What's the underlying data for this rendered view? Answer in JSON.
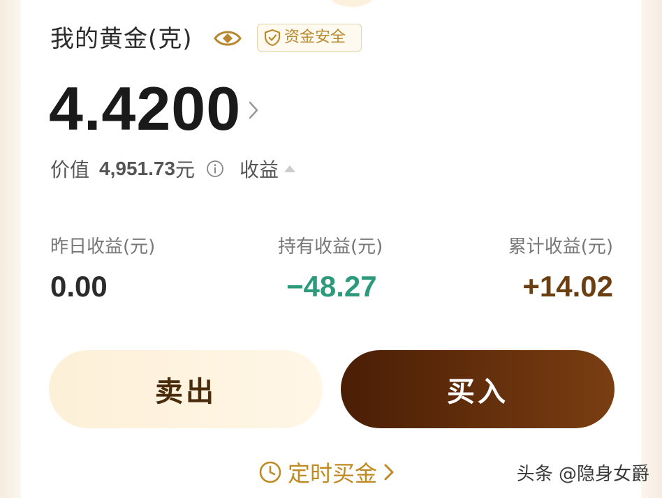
{
  "header": {
    "title": "我的黄金(克)",
    "badge_label": "资金安全"
  },
  "holding": {
    "amount": "4.4200",
    "value_label": "价值",
    "value_amount": "4,951.73",
    "value_unit": "元",
    "earnings_label": "收益"
  },
  "stats": [
    {
      "label": "昨日收益(元)",
      "value": "0.00"
    },
    {
      "label": "持有收益(元)",
      "value": "−48.27"
    },
    {
      "label": "累计收益(元)",
      "value": "+14.02"
    }
  ],
  "actions": {
    "sell_label": "卖出",
    "buy_label": "买入",
    "scheduled_label": "定时买金"
  },
  "watermark": "头条 @隐身女爵",
  "colors": {
    "accent_gold": "#c08a22",
    "negative": "#2e9a7c",
    "positive": "#6b3f12",
    "buy_button": "#5a2a08",
    "sell_button": "#fdf0d8"
  },
  "icons": [
    "eye-icon",
    "shield-check-icon",
    "chevron-right-icon",
    "info-icon",
    "triangle-up-icon",
    "clock-icon"
  ]
}
